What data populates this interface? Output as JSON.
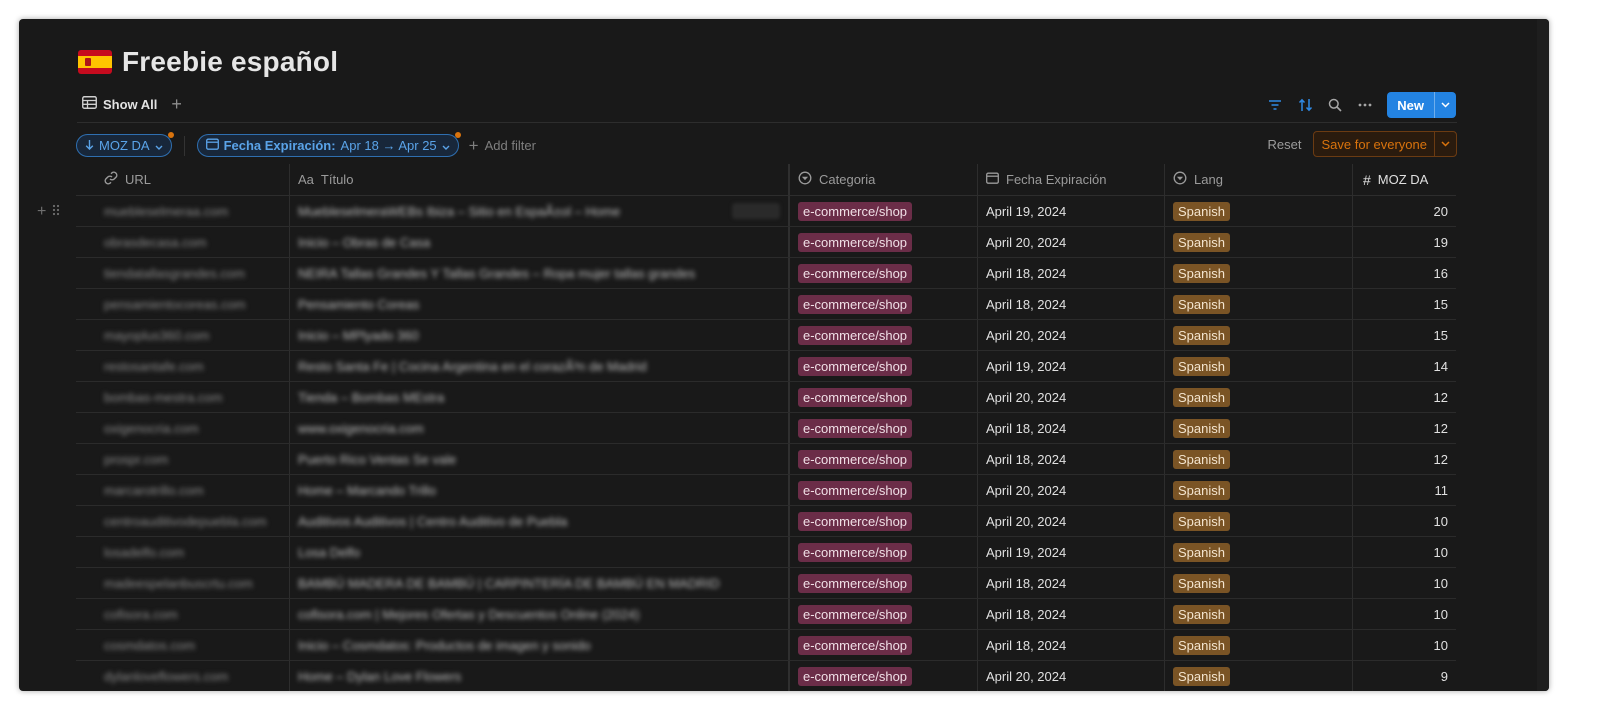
{
  "page": {
    "title": "Freebie español",
    "icon": "spain-flag-icon"
  },
  "views": {
    "active": "Show All"
  },
  "toolbar": {
    "new_label": "New",
    "accent": "#2383e2"
  },
  "filters": {
    "sort_chip": "MOZ DA",
    "date_chip_name": "Fecha Expiración:",
    "date_chip_value": "Apr 18 → Apr 25",
    "add_filter": "Add filter",
    "reset": "Reset",
    "save": "Save for everyone"
  },
  "columns": {
    "url": "URL",
    "title": "Título",
    "category": "Categoria",
    "date": "Fecha Expiración",
    "lang": "Lang",
    "moz": "MOZ DA"
  },
  "rows": [
    {
      "url": "muebleselmeraa.com",
      "title": "MuebleselmeraWEBs Ibiza – Sitio en EspaÃ±ol – Home",
      "category": "e-commerce/shop",
      "date": "April 19, 2024",
      "lang": "Spanish",
      "moz": "20"
    },
    {
      "url": "obrasdecasa.com",
      "title": "Inicio – Obras de Casa",
      "category": "e-commerce/shop",
      "date": "April 20, 2024",
      "lang": "Spanish",
      "moz": "19"
    },
    {
      "url": "tiendatallasgrandes.com",
      "title": "NEIRA Tallas Grandes Y Tallas Grandes – Ropa mujer tallas grandes",
      "category": "e-commerce/shop",
      "date": "April 18, 2024",
      "lang": "Spanish",
      "moz": "16"
    },
    {
      "url": "pensamientocoreas.com",
      "title": "Pensamiento Coreas",
      "category": "e-commerce/shop",
      "date": "April 18, 2024",
      "lang": "Spanish",
      "moz": "15"
    },
    {
      "url": "mayoplus360.com",
      "title": "Inicio – MPlyado 360",
      "category": "e-commerce/shop",
      "date": "April 20, 2024",
      "lang": "Spanish",
      "moz": "15"
    },
    {
      "url": "restosantafe.com",
      "title": "Resto Santa Fe | Cocina Argentina en el corazÃ³n de Madrid",
      "category": "e-commerce/shop",
      "date": "April 19, 2024",
      "lang": "Spanish",
      "moz": "14"
    },
    {
      "url": "bombas-mestra.com",
      "title": "Tienda – Bombas MEstra",
      "category": "e-commerce/shop",
      "date": "April 20, 2024",
      "lang": "Spanish",
      "moz": "12"
    },
    {
      "url": "oxigenocria.com",
      "title": "www.oxigenocria.com",
      "category": "e-commerce/shop",
      "date": "April 18, 2024",
      "lang": "Spanish",
      "moz": "12"
    },
    {
      "url": "prospr.com",
      "title": "Puerto Rico Ventas Se vale",
      "category": "e-commerce/shop",
      "date": "April 18, 2024",
      "lang": "Spanish",
      "moz": "12"
    },
    {
      "url": "marcarotrillo.com",
      "title": "Home – Marcando Trillo",
      "category": "e-commerce/shop",
      "date": "April 20, 2024",
      "lang": "Spanish",
      "moz": "11"
    },
    {
      "url": "centroauditivodepuebla.com",
      "title": "Auditivos Auditivos | Centro Auditivo de Puebla",
      "category": "e-commerce/shop",
      "date": "April 20, 2024",
      "lang": "Spanish",
      "moz": "10"
    },
    {
      "url": "losadelfo.com",
      "title": "Losa Delfo",
      "category": "e-commerce/shop",
      "date": "April 19, 2024",
      "lang": "Spanish",
      "moz": "10"
    },
    {
      "url": "madeespelanbuscrtu.com",
      "title": "BAMBÚ MADERA DE BAMBÚ | CARPINTERÍA DE BAMBÚ EN MADRID",
      "category": "e-commerce/shop",
      "date": "April 18, 2024",
      "lang": "Spanish",
      "moz": "10"
    },
    {
      "url": "cofisora.com",
      "title": "cofisora.com | Mejores Ofertas y Descuentos Online (2024)",
      "category": "e-commerce/shop",
      "date": "April 18, 2024",
      "lang": "Spanish",
      "moz": "10"
    },
    {
      "url": "cosmdatos.com",
      "title": "Inicio – Cosmdatos: Productos de imagen y sonido",
      "category": "e-commerce/shop",
      "date": "April 18, 2024",
      "lang": "Spanish",
      "moz": "10"
    },
    {
      "url": "dylanloveflowers.com",
      "title": "Home – Dylan Love Flowers",
      "category": "e-commerce/shop",
      "date": "April 20, 2024",
      "lang": "Spanish",
      "moz": "9"
    }
  ]
}
